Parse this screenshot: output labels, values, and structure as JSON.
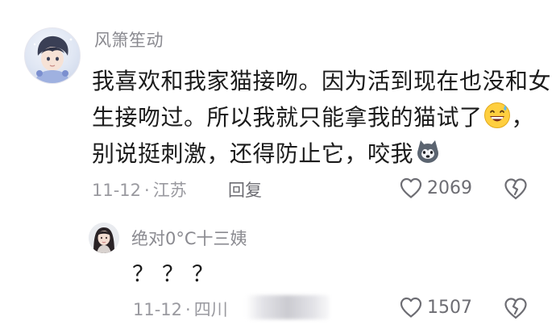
{
  "comment": {
    "author": "风箫笙动",
    "lines": [
      "我喜欢和我家猫接吻。因为活到现在也没和女",
      "生接吻过。所以我就只能拿我的猫试了",
      "，",
      "别说挺刺激，还得防止它，咬我"
    ],
    "emoji_1": "grinning-sweat-emoji",
    "emoji_2": "husky-dog-emoji",
    "date": "11-12",
    "dot": "·",
    "location": "江苏",
    "reply_label": "回复",
    "likes": "2069",
    "icons": {
      "like": "heart-outline-icon",
      "dislike": "broken-heart-icon"
    }
  },
  "reply": {
    "author": "绝对0°C十三姨",
    "text": "？？？",
    "date": "11-12",
    "dot": "·",
    "location_partial": "四川",
    "likes": "1507"
  },
  "colors": {
    "text_primary": "#1b1b1b",
    "text_secondary": "#8a8a90",
    "icon": "#6d6d73",
    "background": "#ffffff"
  }
}
